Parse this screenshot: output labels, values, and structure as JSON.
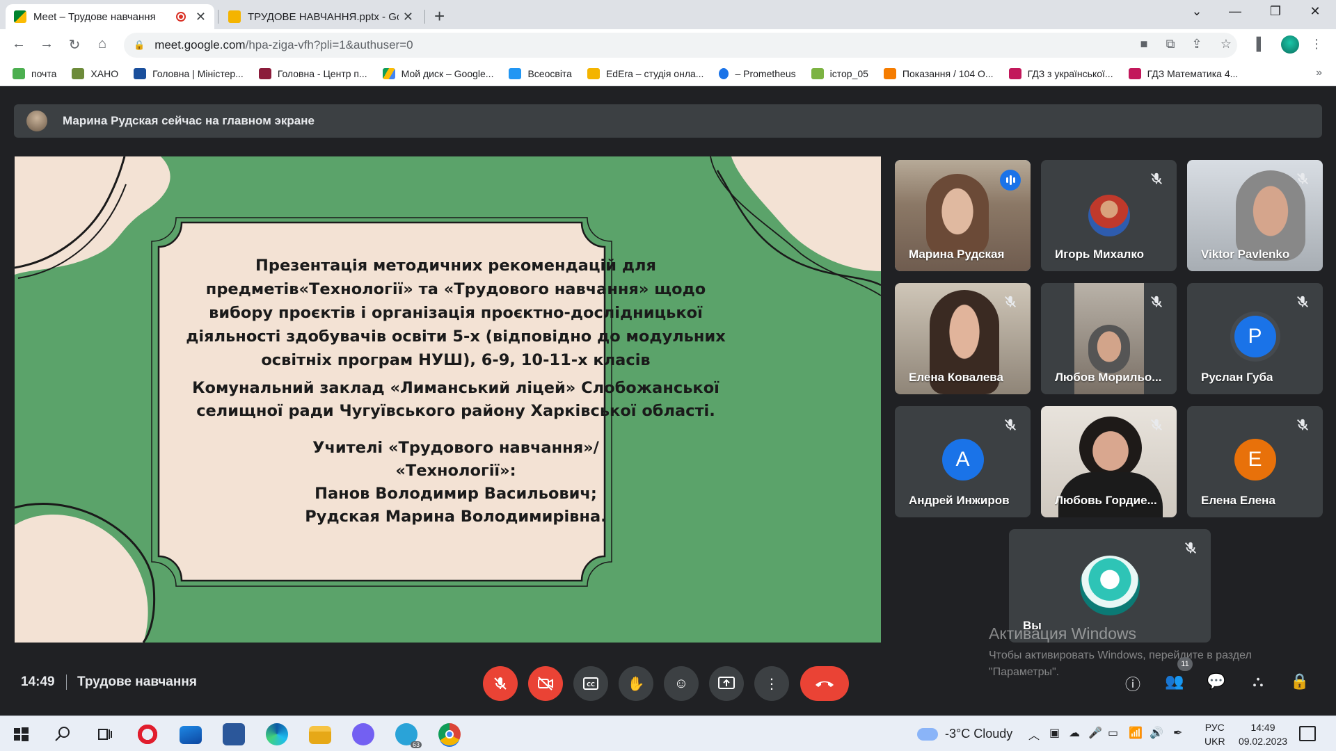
{
  "browser": {
    "tabs": [
      {
        "title": "Meet – Трудове навчання",
        "recording": true
      },
      {
        "title": "ТРУДОВЕ НАВЧАННЯ.pptx - Goo"
      }
    ],
    "url_host": "meet.google.com",
    "url_path": "/hpa-ziga-vfh?pli=1&authuser=0",
    "bookmarks": [
      {
        "label": "почта",
        "color": "#4caf50"
      },
      {
        "label": "ХАНО",
        "color": "#6d8b3a"
      },
      {
        "label": "Головна | Міністер...",
        "color": "#1a4f9c"
      },
      {
        "label": "Головна - Центр п...",
        "color": "#8b1c3b"
      },
      {
        "label": "Мой диск – Google...",
        "color": "#fbbc04"
      },
      {
        "label": "Всеосвіта",
        "color": "#2196f3"
      },
      {
        "label": "EdEra – студія онла...",
        "color": "#f4b400"
      },
      {
        "label": "– Prometheus",
        "color": "#1a73e8"
      },
      {
        "label": "істор_05",
        "color": "#7cb342"
      },
      {
        "label": "Показання / 104 О...",
        "color": "#f57c00"
      },
      {
        "label": "ГДЗ з української...",
        "color": "#c2185b"
      },
      {
        "label": "ГДЗ Математика 4...",
        "color": "#c2185b"
      }
    ]
  },
  "meet": {
    "banner": "Марина Рудская сейчас на главном экране",
    "slide": {
      "title_lines": [
        "Презентація методичних рекомендацій для",
        "предметів«Технології» та «Трудового навчання» щодо",
        "вибору проєктів і організація проєктно-дослідницької",
        "діяльності здобувачів освіти 5-х (відповідно до модульних",
        "освітніх програм НУШ),  6-9, 10-11-х класів"
      ],
      "org_lines": [
        "Комунальний заклад «Лиманський ліцей» Слобожанської",
        "селищної ради Чугуївського району Харківської області."
      ],
      "teacher_lines": [
        "Учителі «Трудового навчання»/",
        "«Технології»:",
        "Панов Володимир Васильович;",
        "Рудская Марина Володимирівна."
      ]
    },
    "participants": [
      {
        "name": "Марина Рудская",
        "speaking": true
      },
      {
        "name": "Игорь Михалко",
        "muted": true
      },
      {
        "name": "Viktor Pavlenko",
        "muted": true
      },
      {
        "name": "Елена Ковалева",
        "muted": true
      },
      {
        "name": "Любов Морильо...",
        "muted": true
      },
      {
        "name": "Руслан Губа",
        "muted": true,
        "initial": "P",
        "color": "#1a73e8"
      },
      {
        "name": "Андрей Инжиров",
        "muted": true,
        "initial": "A",
        "color": "#1a73e8"
      },
      {
        "name": "Любовь Гордие...",
        "muted": true
      },
      {
        "name": "Елена Елена",
        "muted": true,
        "initial": "E",
        "color": "#e8710a"
      },
      {
        "name": "Вы",
        "muted": true
      }
    ],
    "time": "14:49",
    "meeting_name": "Трудове навчання",
    "people_count": "11",
    "activate_title": "Активация Windows",
    "activate_text": "Чтобы активировать Windows, перейдите в раздел \"Параметры\"."
  },
  "taskbar": {
    "weather": "-3°C  Cloudy",
    "lang_top": "РУС",
    "lang_bottom": "UKR",
    "time": "14:49",
    "date": "09.02.2023",
    "telegram_badge": "63"
  }
}
